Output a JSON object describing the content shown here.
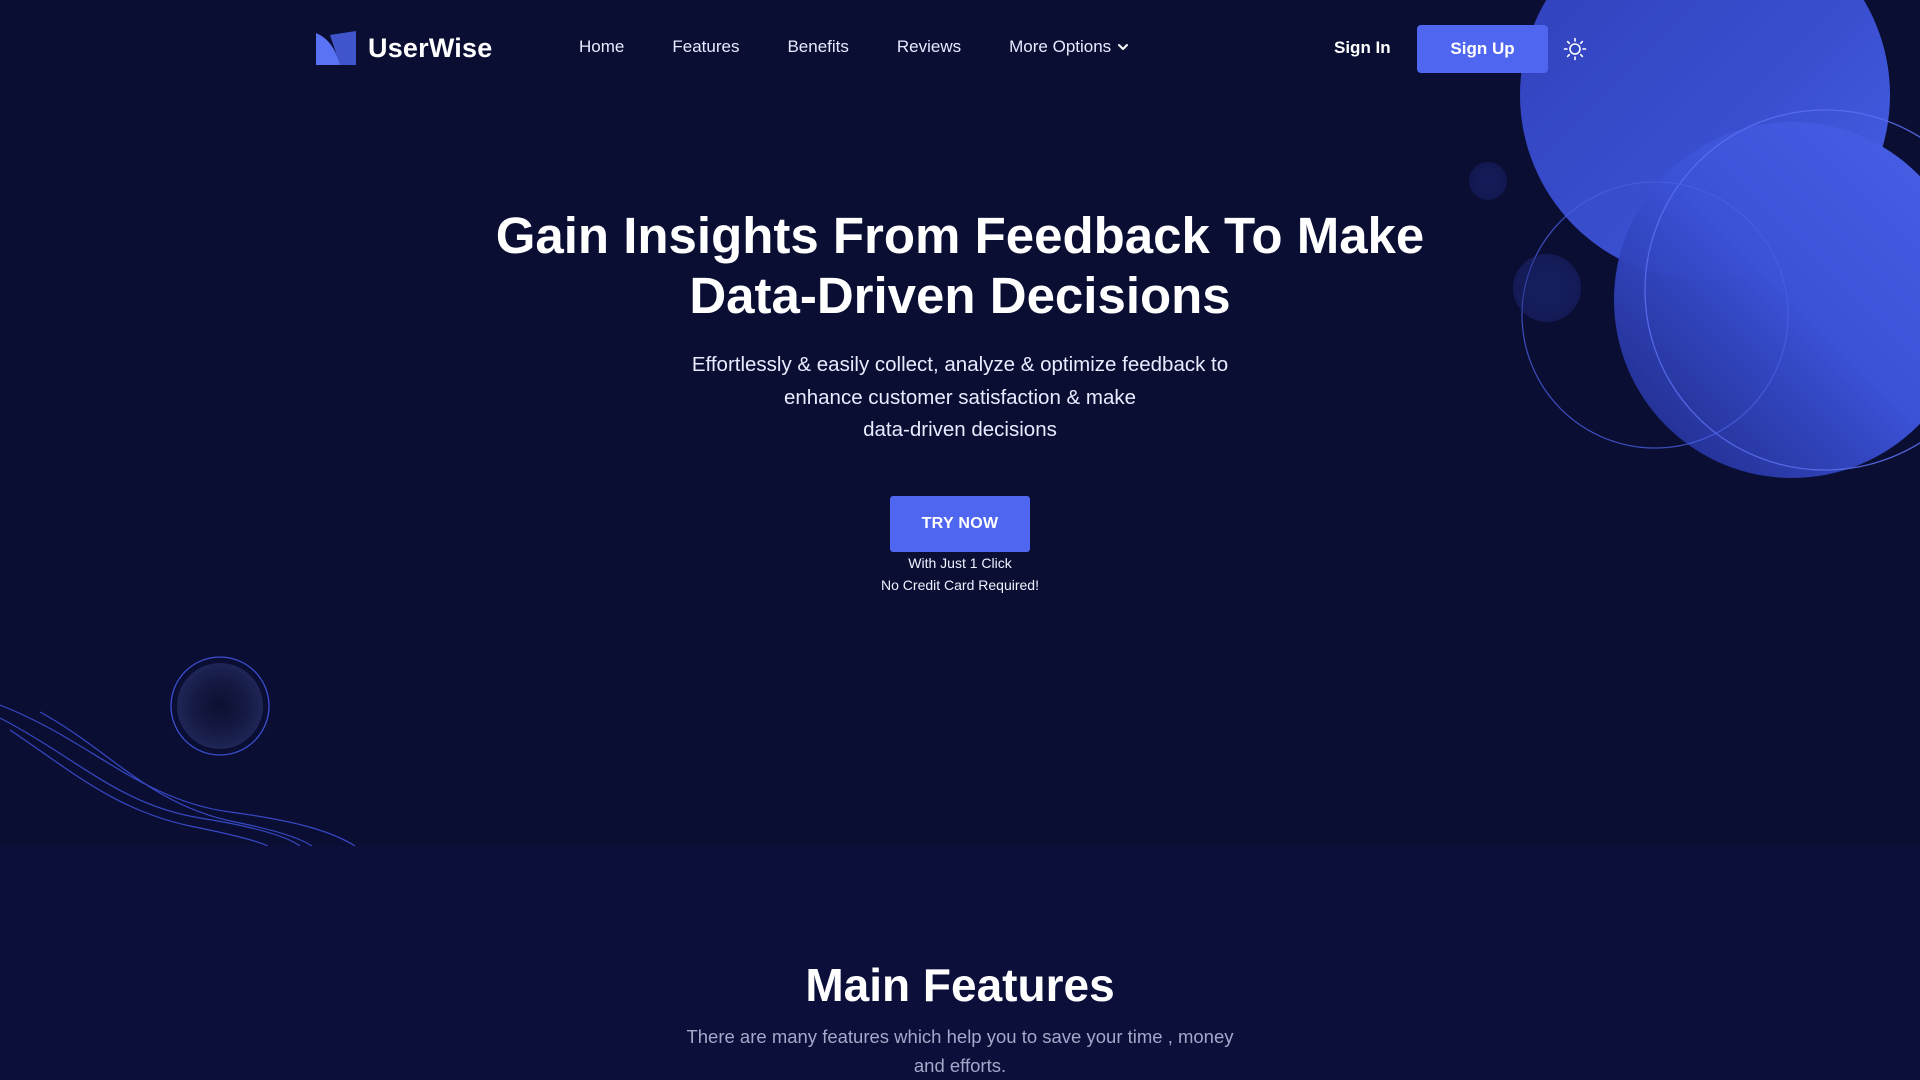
{
  "brand": {
    "name": "UserWise",
    "accent_color": "#4f66f0",
    "background_color": "#0a0e33"
  },
  "nav": {
    "links": [
      {
        "label": "Home"
      },
      {
        "label": "Features"
      },
      {
        "label": "Benefits"
      },
      {
        "label": "Reviews"
      },
      {
        "label": "More Options",
        "icon": "chevron-down-icon"
      }
    ],
    "sign_in": "Sign In",
    "sign_up": "Sign Up",
    "theme_icon": "sun-icon"
  },
  "hero": {
    "title_line1": "Gain Insights From Feedback To Make",
    "title_line2": "Data-Driven Decisions",
    "subtitle_lines": [
      "Effortlessly & easily collect, analyze & optimize feedback to",
      "enhance customer satisfaction & make",
      "data-driven decisions"
    ],
    "cta_label": "TRY NOW",
    "cta_note_1": "With Just 1 Click",
    "cta_note_2": "No Credit Card Required!"
  },
  "features": {
    "title": "Main Features",
    "subtitle_lines": [
      "There are many features which help you to save your time , money",
      "and efforts."
    ]
  }
}
